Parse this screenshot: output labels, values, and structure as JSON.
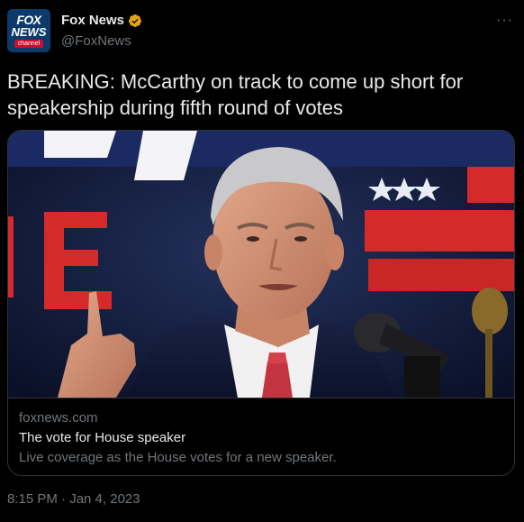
{
  "account": {
    "display_name": "Fox News",
    "handle": "@FoxNews",
    "avatar": {
      "line1": "FOX",
      "line2": "NEWS",
      "line3": "channel"
    },
    "verified_icon": "verified-badge-icon",
    "verified_color": "#e2a60b"
  },
  "more_label": "···",
  "tweet": {
    "text": "BREAKING: McCarthy on track to come up short for speakership during fifth round of votes"
  },
  "card": {
    "image_icon": "news-photo",
    "domain": "foxnews.com",
    "title": "The vote for House speaker",
    "description": "Live coverage as the House votes for a new speaker."
  },
  "timestamp": "8:15 PM · Jan 4, 2023",
  "colors": {
    "background": "#000000",
    "text_primary": "#e7e9ea",
    "text_secondary": "#71767b",
    "border": "#2f3336",
    "brand_blue": "#0b3a6b",
    "brand_red": "#c8102e"
  }
}
